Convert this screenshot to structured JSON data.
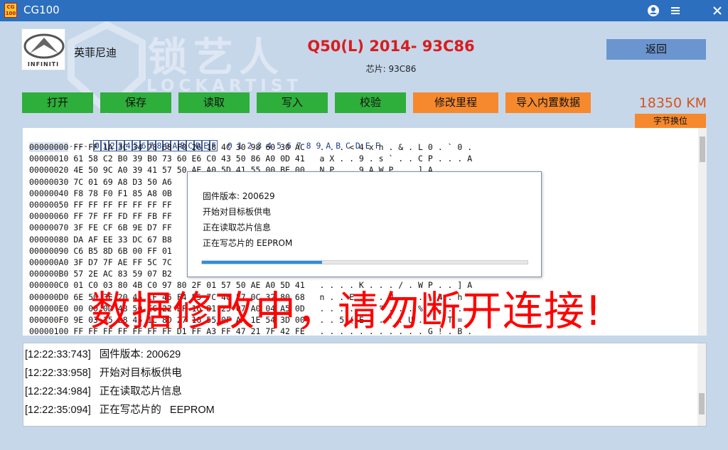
{
  "window": {
    "logo_text": "CG 100",
    "title": "CG100",
    "icons": [
      "user-icon",
      "menu-icon",
      "close-icon"
    ]
  },
  "brand": {
    "logo_text": "INFINITI",
    "name": "英菲尼迪"
  },
  "watermark": {
    "text": "锁艺人",
    "subtext": "LOCKARTIST"
  },
  "vehicle": {
    "title": "Q50(L) 2014- 93C86",
    "chip": "芯片: 93C86"
  },
  "toolbar": {
    "open": "打开",
    "save": "保存",
    "read": "读取",
    "write": "写入",
    "verify": "校验",
    "modify_mileage": "修改里程",
    "import_builtin": "导入内置数据",
    "back": "返回"
  },
  "mileage": {
    "value": "18350 KM",
    "byte_swap": "字节换位"
  },
  "hex": {
    "header_dashes": "--------",
    "header_cols": [
      "0",
      "1",
      "2",
      "3",
      "4",
      "5",
      "6",
      "7",
      "8",
      "9",
      "A",
      "B",
      "C",
      "D",
      "E",
      "F"
    ],
    "header_ascii": "0 1 2 3 4 5 6 7 8 9 A B C D E F",
    "rows": [
      {
        "addr": "00000000",
        "bytes": "FF FF 1A 3C 34 78 68 F0 26 18 4C 30 98 60 30 AC",
        "ascii": ". . . < 4 x h . & . L 0 . ` 0 ."
      },
      {
        "addr": "00000010",
        "bytes": "61 58 C2 B0 39 B0 73 60 E6 C0 43 50 86 A0 0D 41",
        "ascii": "a X . . 9 . s ` . . C P . . . A"
      },
      {
        "addr": "00000020",
        "bytes": "4E 50 9C A0 39 41 57 50 AE A0 5D 41 55 00 BE 00",
        "ascii": "N P . . 9 A W P . . ] A"
      },
      {
        "addr": "00000030",
        "bytes": "7C 01 69 A8 D3 50 A6",
        "ascii": ""
      },
      {
        "addr": "00000040",
        "bytes": "F8 78 F0 F1 85 A8 0B",
        "ascii": ""
      },
      {
        "addr": "00000050",
        "bytes": "FF FF FF FF FF FF FF",
        "ascii": ""
      },
      {
        "addr": "00000060",
        "bytes": "FF 7F FF FD FF FB FF",
        "ascii": ""
      },
      {
        "addr": "00000070",
        "bytes": "3F FE CF 6B 9E D7 FF",
        "ascii": ""
      },
      {
        "addr": "00000080",
        "bytes": "DA AF EE 33 DC 67 B8",
        "ascii": ""
      },
      {
        "addr": "00000090",
        "bytes": "C6 B5 8D 6B 00 FF 01",
        "ascii": ""
      },
      {
        "addr": "000000A0",
        "bytes": "3F D7 7F AE FF 5C 7C",
        "ascii": ""
      },
      {
        "addr": "000000B0",
        "bytes": "57 2E AC 83 59 07 B2",
        "ascii": ""
      },
      {
        "addr": "000000C0",
        "bytes": "01 C0 03 80 4B C0 97 80 2F 01 57 50 AE A0 5D 41",
        "ascii": ". . . . K . . . / . W P . . ] A"
      },
      {
        "addr": "000000D0",
        "bytes": "6E 50 3E 20 45 CF 45 F4 55 7C 40 F7 0C 32 80 68",
        "ascii": "n . . E . . . U . . . . 4 . h"
      },
      {
        "addr": "000000E0",
        "bytes": "00 00 0D 48 50 EC 22 BF 16 81 25 07 A0 04 A5 0D",
        "ascii": ". . . . . . \" . . . % . . . . ."
      },
      {
        "addr": "000000F0",
        "bytes": "9E 03 35 28 45 1C 8D 27 16 55 0F AA 1E 54 3D 00",
        "ascii": ". . 5 ( E . . ' . U . . . T = ."
      },
      {
        "addr": "00000100",
        "bytes": "FF FF FF FF FF FF FF D1 FF A3 FF 47 21 7F 42 FE",
        "ascii": ". . . . . . . . . . . G ! . B ."
      }
    ]
  },
  "dialog": {
    "lines": [
      "固件版本: 200629",
      "开始对目标板供电",
      "正在读取芯片信息",
      "正在写芯片的   EEPROM"
    ],
    "progress_fraction": 0.37
  },
  "warning": "数据修改中，请勿断开连接!",
  "log": {
    "lines": [
      "[12:22:33:743]   固件版本: 200629",
      "[12:22:33:958]   开始对目标板供电",
      "[12:22:34:984]   正在读取芯片信息",
      "[12:22:35:094]   正在写芯片的   EEPROM"
    ]
  }
}
